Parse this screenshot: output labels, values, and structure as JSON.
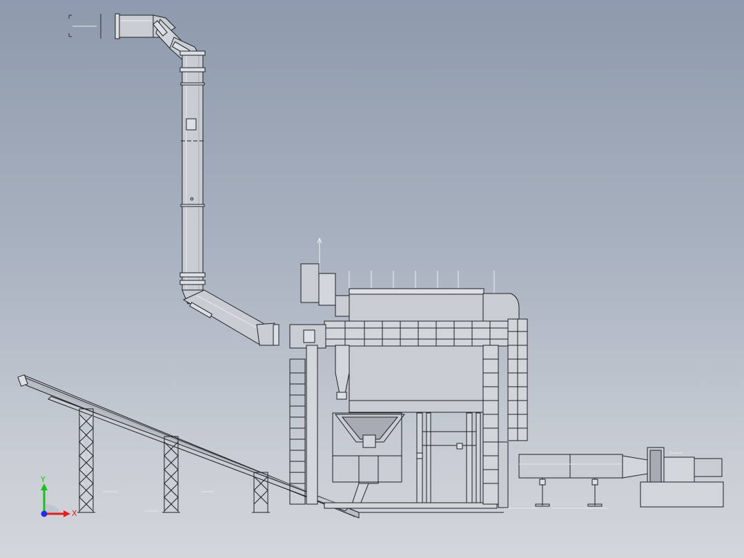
{
  "view": {
    "background_top": "#8e9aad",
    "background_bottom": "#d3d6db",
    "model_stroke": "#1c1f24",
    "model_fill": "#c9ccd2",
    "model_fill_light": "#dcdfe4",
    "model_fill_dark": "#a7abb3"
  },
  "triad": {
    "x_label": "X",
    "y_label": "Y",
    "x_color": "#e02020",
    "y_color": "#1bbf1b",
    "z_color": "#2030e0"
  }
}
